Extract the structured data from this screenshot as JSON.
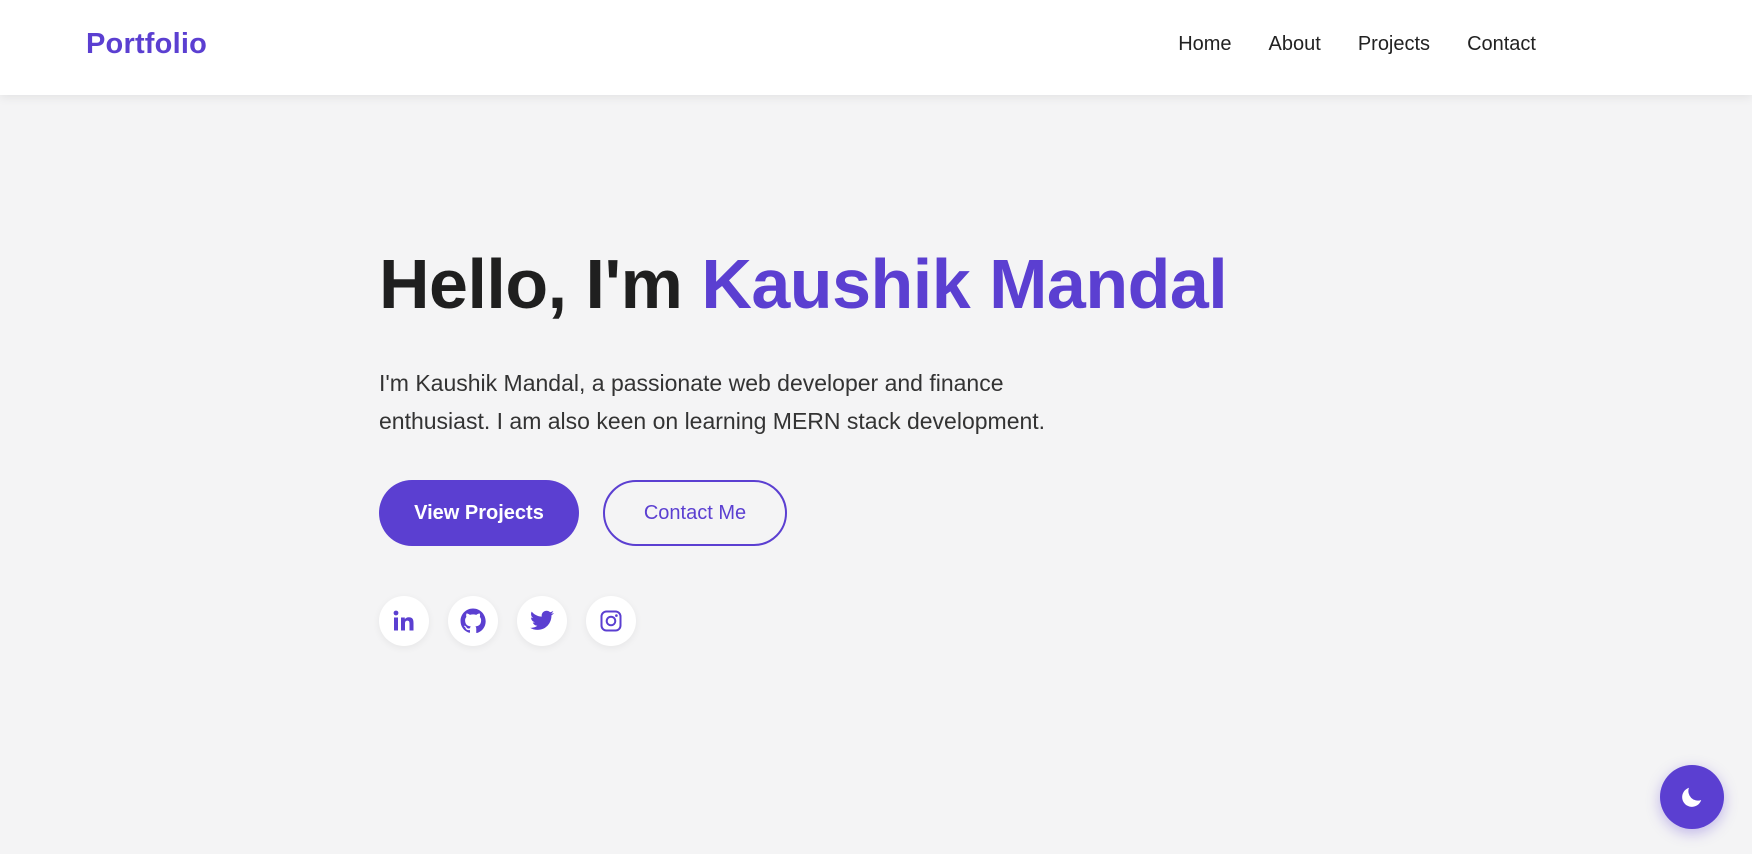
{
  "header": {
    "brand": "Portfolio",
    "nav": [
      {
        "label": "Home"
      },
      {
        "label": "About"
      },
      {
        "label": "Projects"
      },
      {
        "label": "Contact"
      }
    ]
  },
  "hero": {
    "greeting": "Hello, I'm ",
    "name": "Kaushik Mandal",
    "description": "I'm Kaushik Mandal, a passionate web developer and finance enthusiast. I am also keen on learning MERN stack development.",
    "primary_button": "View Projects",
    "secondary_button": "Contact Me"
  },
  "social": [
    {
      "icon": "linkedin-icon"
    },
    {
      "icon": "github-icon"
    },
    {
      "icon": "twitter-icon"
    },
    {
      "icon": "instagram-icon"
    }
  ],
  "theme_toggle": {
    "icon": "moon-icon"
  },
  "colors": {
    "accent": "#5b3fd1",
    "background": "#f4f4f5",
    "header_bg": "#ffffff",
    "text_dark": "#1f1f1f"
  }
}
